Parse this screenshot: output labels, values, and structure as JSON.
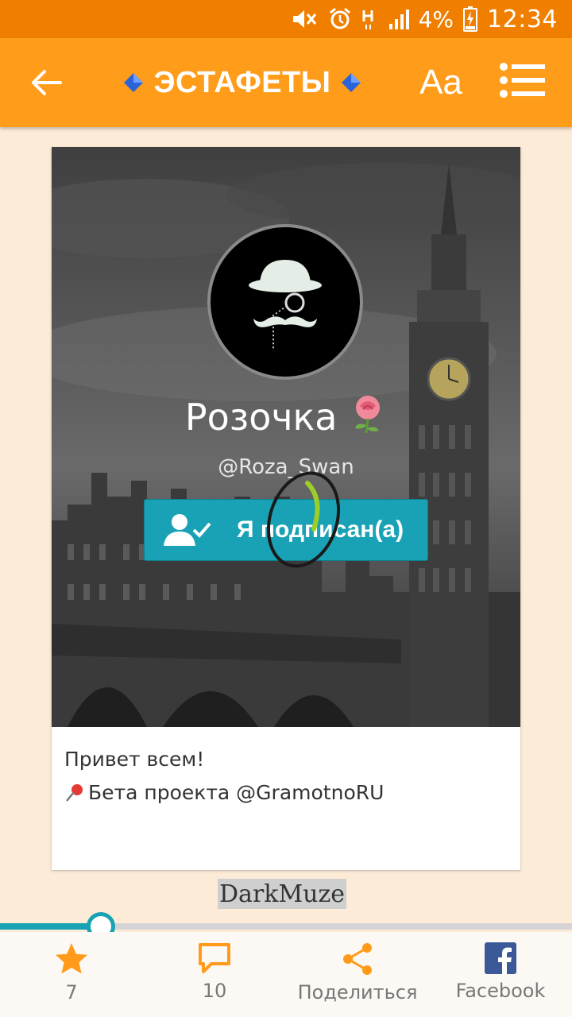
{
  "status_bar": {
    "battery_percent": "4%",
    "time": "12:34",
    "icons": [
      "mute-icon",
      "alarm-icon",
      "network-h-icon",
      "signal-icon",
      "battery-charging-icon"
    ]
  },
  "app_bar": {
    "title": "ЭСТАФЕТЫ",
    "font_button_label": "Aa",
    "icons": [
      "back-arrow-icon",
      "diamond-icon",
      "list-menu-icon"
    ],
    "background": "#ff9c1a"
  },
  "profile": {
    "name": "Розочка",
    "handle": "@Roza_Swan",
    "subscribe_label": "Я подписан(а)",
    "subscribe_color": "#19a2b5"
  },
  "post": {
    "greeting": "Привет всем!",
    "beta_text": "Бета проекта @GramotnoRU"
  },
  "author_tag": "DarkMuze",
  "progress": {
    "value": 0.175,
    "color": "#17a3b4"
  },
  "bottom_bar": {
    "star_count": "7",
    "comment_count": "10",
    "share_label": "Поделиться",
    "facebook_label": "Facebook"
  }
}
